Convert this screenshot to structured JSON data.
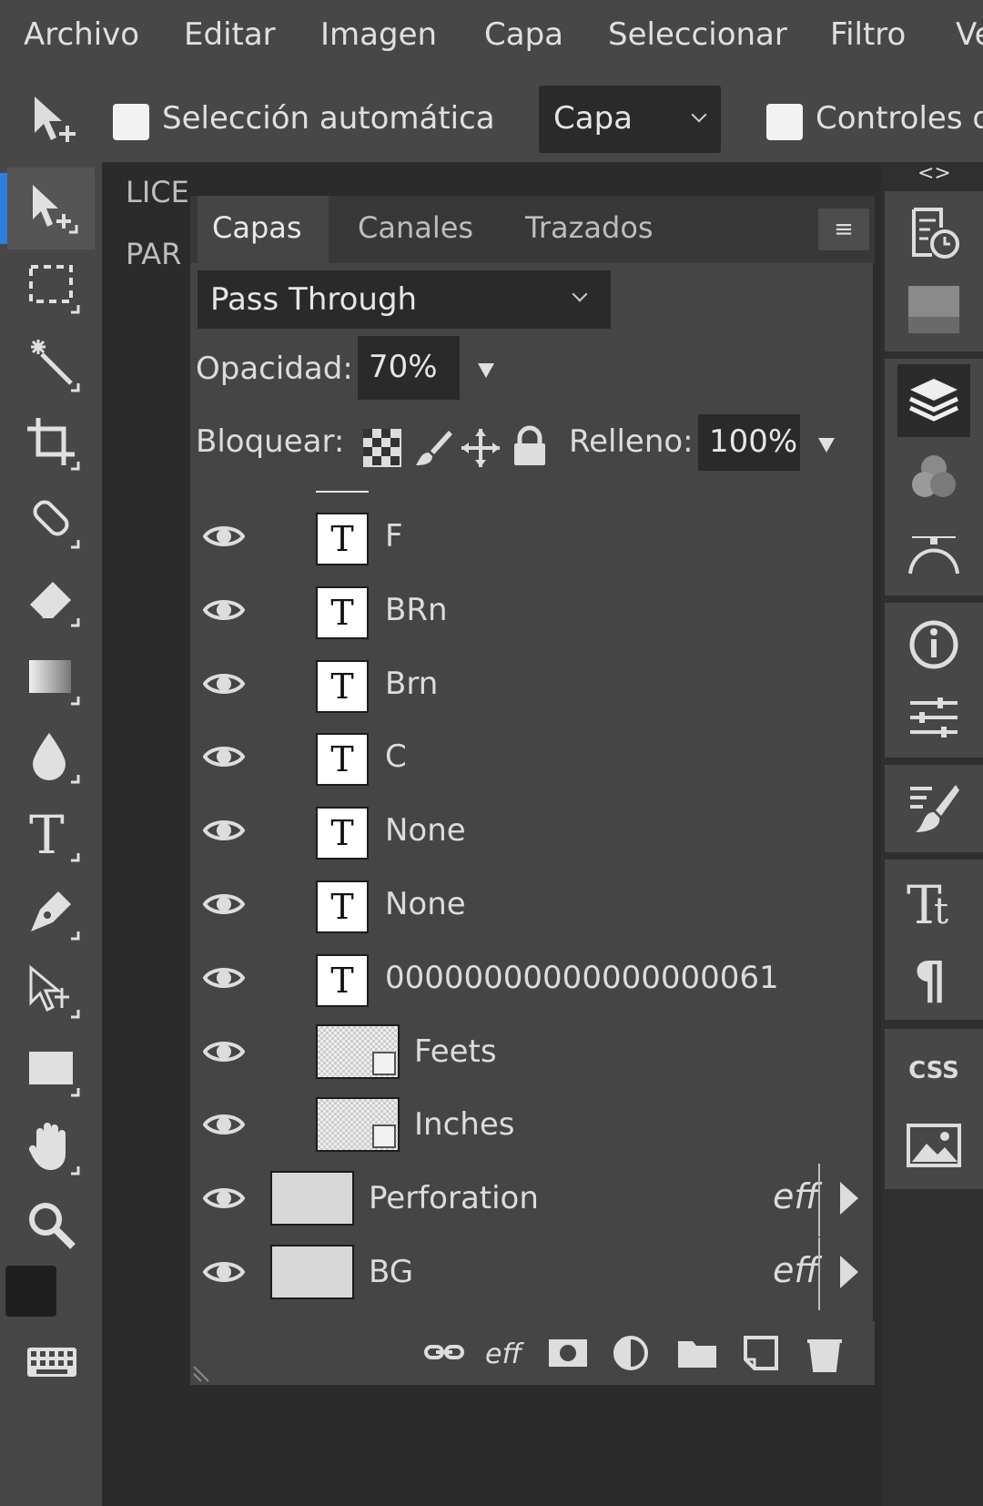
{
  "menu": [
    "Archivo",
    "Editar",
    "Imagen",
    "Capa",
    "Seleccionar",
    "Filtro",
    "Ve"
  ],
  "options": {
    "auto_select_label": "Selección automática",
    "target_value": "Capa",
    "controls_label": "Controles d"
  },
  "doc": {
    "line1": "LICE",
    "line2": "PAR"
  },
  "panel": {
    "tabs": [
      "Capas",
      "Canales",
      "Trazados"
    ],
    "menu_glyph": "≡",
    "blend_mode": "Pass Through",
    "opacity_label": "Opacidad:",
    "opacity_value": "70%",
    "lock_label": "Bloquear:",
    "fill_label": "Relleno:",
    "fill_value": "100%",
    "fx_label": "eff",
    "layers": [
      {
        "name": "F",
        "kind": "text"
      },
      {
        "name": "BRn",
        "kind": "text"
      },
      {
        "name": "Brn",
        "kind": "text"
      },
      {
        "name": "C",
        "kind": "text"
      },
      {
        "name": "None",
        "kind": "text"
      },
      {
        "name": "None",
        "kind": "text"
      },
      {
        "name": "00000000000000000061",
        "kind": "text"
      },
      {
        "name": "Feets",
        "kind": "smart"
      },
      {
        "name": "Inches",
        "kind": "smart"
      },
      {
        "name": "Perforation",
        "kind": "image",
        "fx": true
      },
      {
        "name": "BG",
        "kind": "image",
        "fx": true
      }
    ],
    "text_thumb_glyph": "T"
  },
  "right_strip": {
    "collapse_glyph": "<>",
    "css_label": "CSS"
  },
  "colors": {
    "accent": "#2d7fe0",
    "panel": "#454545",
    "chrome": "#474747"
  }
}
